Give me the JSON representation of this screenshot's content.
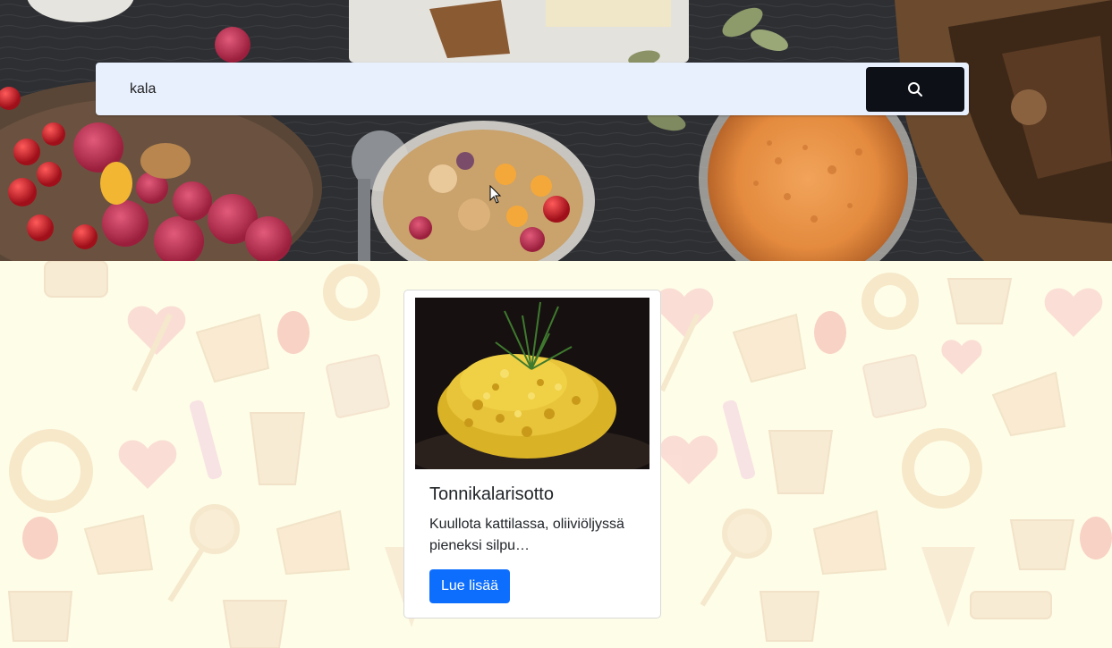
{
  "search": {
    "value": "kala",
    "button_icon": "search-icon"
  },
  "results": [
    {
      "title": "Tonnikalarisotto",
      "excerpt": "Kuullota kattilassa, oliiviöljyssä pieneksi silpu…",
      "button_label": "Lue lisää"
    }
  ],
  "colors": {
    "search_bg": "#e8f0fe",
    "search_button": "#0d1117",
    "primary_button": "#0d6efd",
    "pattern_bg": "#fefde8"
  }
}
